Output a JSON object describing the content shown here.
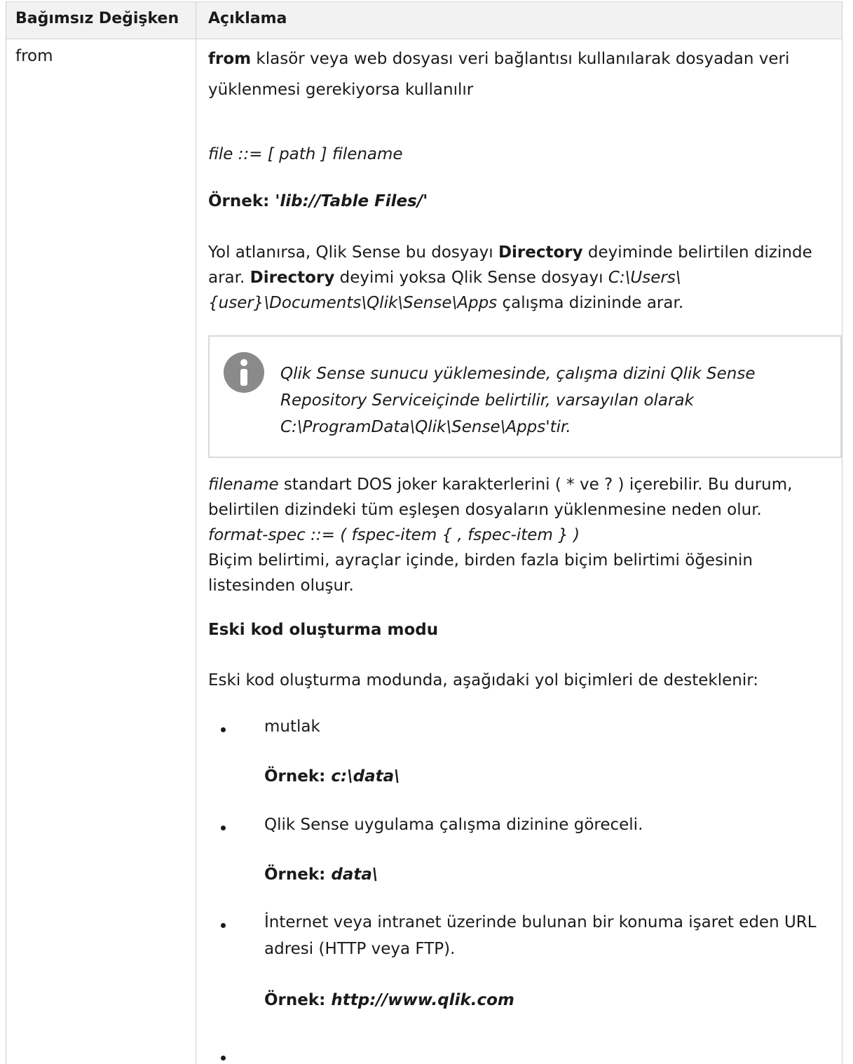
{
  "header": {
    "col1": "Bağımsız Değişken",
    "col2": "Açıklama"
  },
  "row": {
    "name": "from",
    "intro_bold": "from",
    "intro_rest_line1": " klasör veya web dosyası veri bağlantısı kullanılarak dosyadan veri",
    "intro_rest_line2": "yüklenmesi gerekiyorsa kullanılır",
    "syntax": "file ::= [ path ] filename",
    "example1_label": "Örnek: ",
    "example1_value": "'lib://Table Files/'",
    "para1_a": "Yol atlanırsa, Qlik Sense bu dosyayı ",
    "para1_b": "Directory",
    "para1_c": " deyiminde belirtilen dizinde",
    "para2_a": "arar. ",
    "para2_b": "Directory",
    "para2_c": " deyimi yoksa Qlik Sense dosyayı ",
    "para2_d": "C:\\Users\\",
    "para3_a": "{user}\\Documents\\Qlik\\Sense\\Apps",
    "para3_b": " çalışma dizininde arar.",
    "note_line1": "Qlik Sense sunucu yüklemesinde, çalışma dizini Qlik Sense",
    "note_line2": "Repository Serviceiçinde belirtilir, varsayılan olarak",
    "note_line3": "C:\\ProgramData\\Qlik\\Sense\\Apps'tir.",
    "fn_italic": "filename",
    "fn_rest": " standart DOS joker karakterlerini ( * ve ? ) içerebilir. Bu durum,",
    "fn_line2": "belirtilen dizindeki tüm eşleşen dosyaların yüklenmesine neden olur.",
    "fn_line3": "format-spec ::= ( fspec-item { , fspec-item } )",
    "fn_line4": "Biçim belirtimi, ayraçlar içinde, birden fazla biçim belirtimi öğesinin",
    "fn_line5": "listesinden oluşur.",
    "legacy_heading": "Eski kod oluşturma modu",
    "legacy_intro": "Eski kod oluşturma modunda, aşağıdaki yol biçimleri de desteklenir:",
    "bullets": [
      {
        "text": "mutlak",
        "example_label": "Örnek: ",
        "example_value": "c:\\data\\"
      },
      {
        "text": "Qlik Sense uygulama çalışma dizinine göreceli.",
        "example_label": "Örnek: ",
        "example_value": "data\\"
      },
      {
        "text_line1": "İnternet veya intranet üzerinde bulunan bir konuma işaret eden URL",
        "text_line2": "adresi (HTTP veya FTP).",
        "example_label": "Örnek: ",
        "example_value": "http://www.qlik.com"
      }
    ]
  },
  "colors": {
    "header_bg": "#f2f2f2",
    "border": "#cfcfcf",
    "note_icon": "#8a8a8a"
  }
}
